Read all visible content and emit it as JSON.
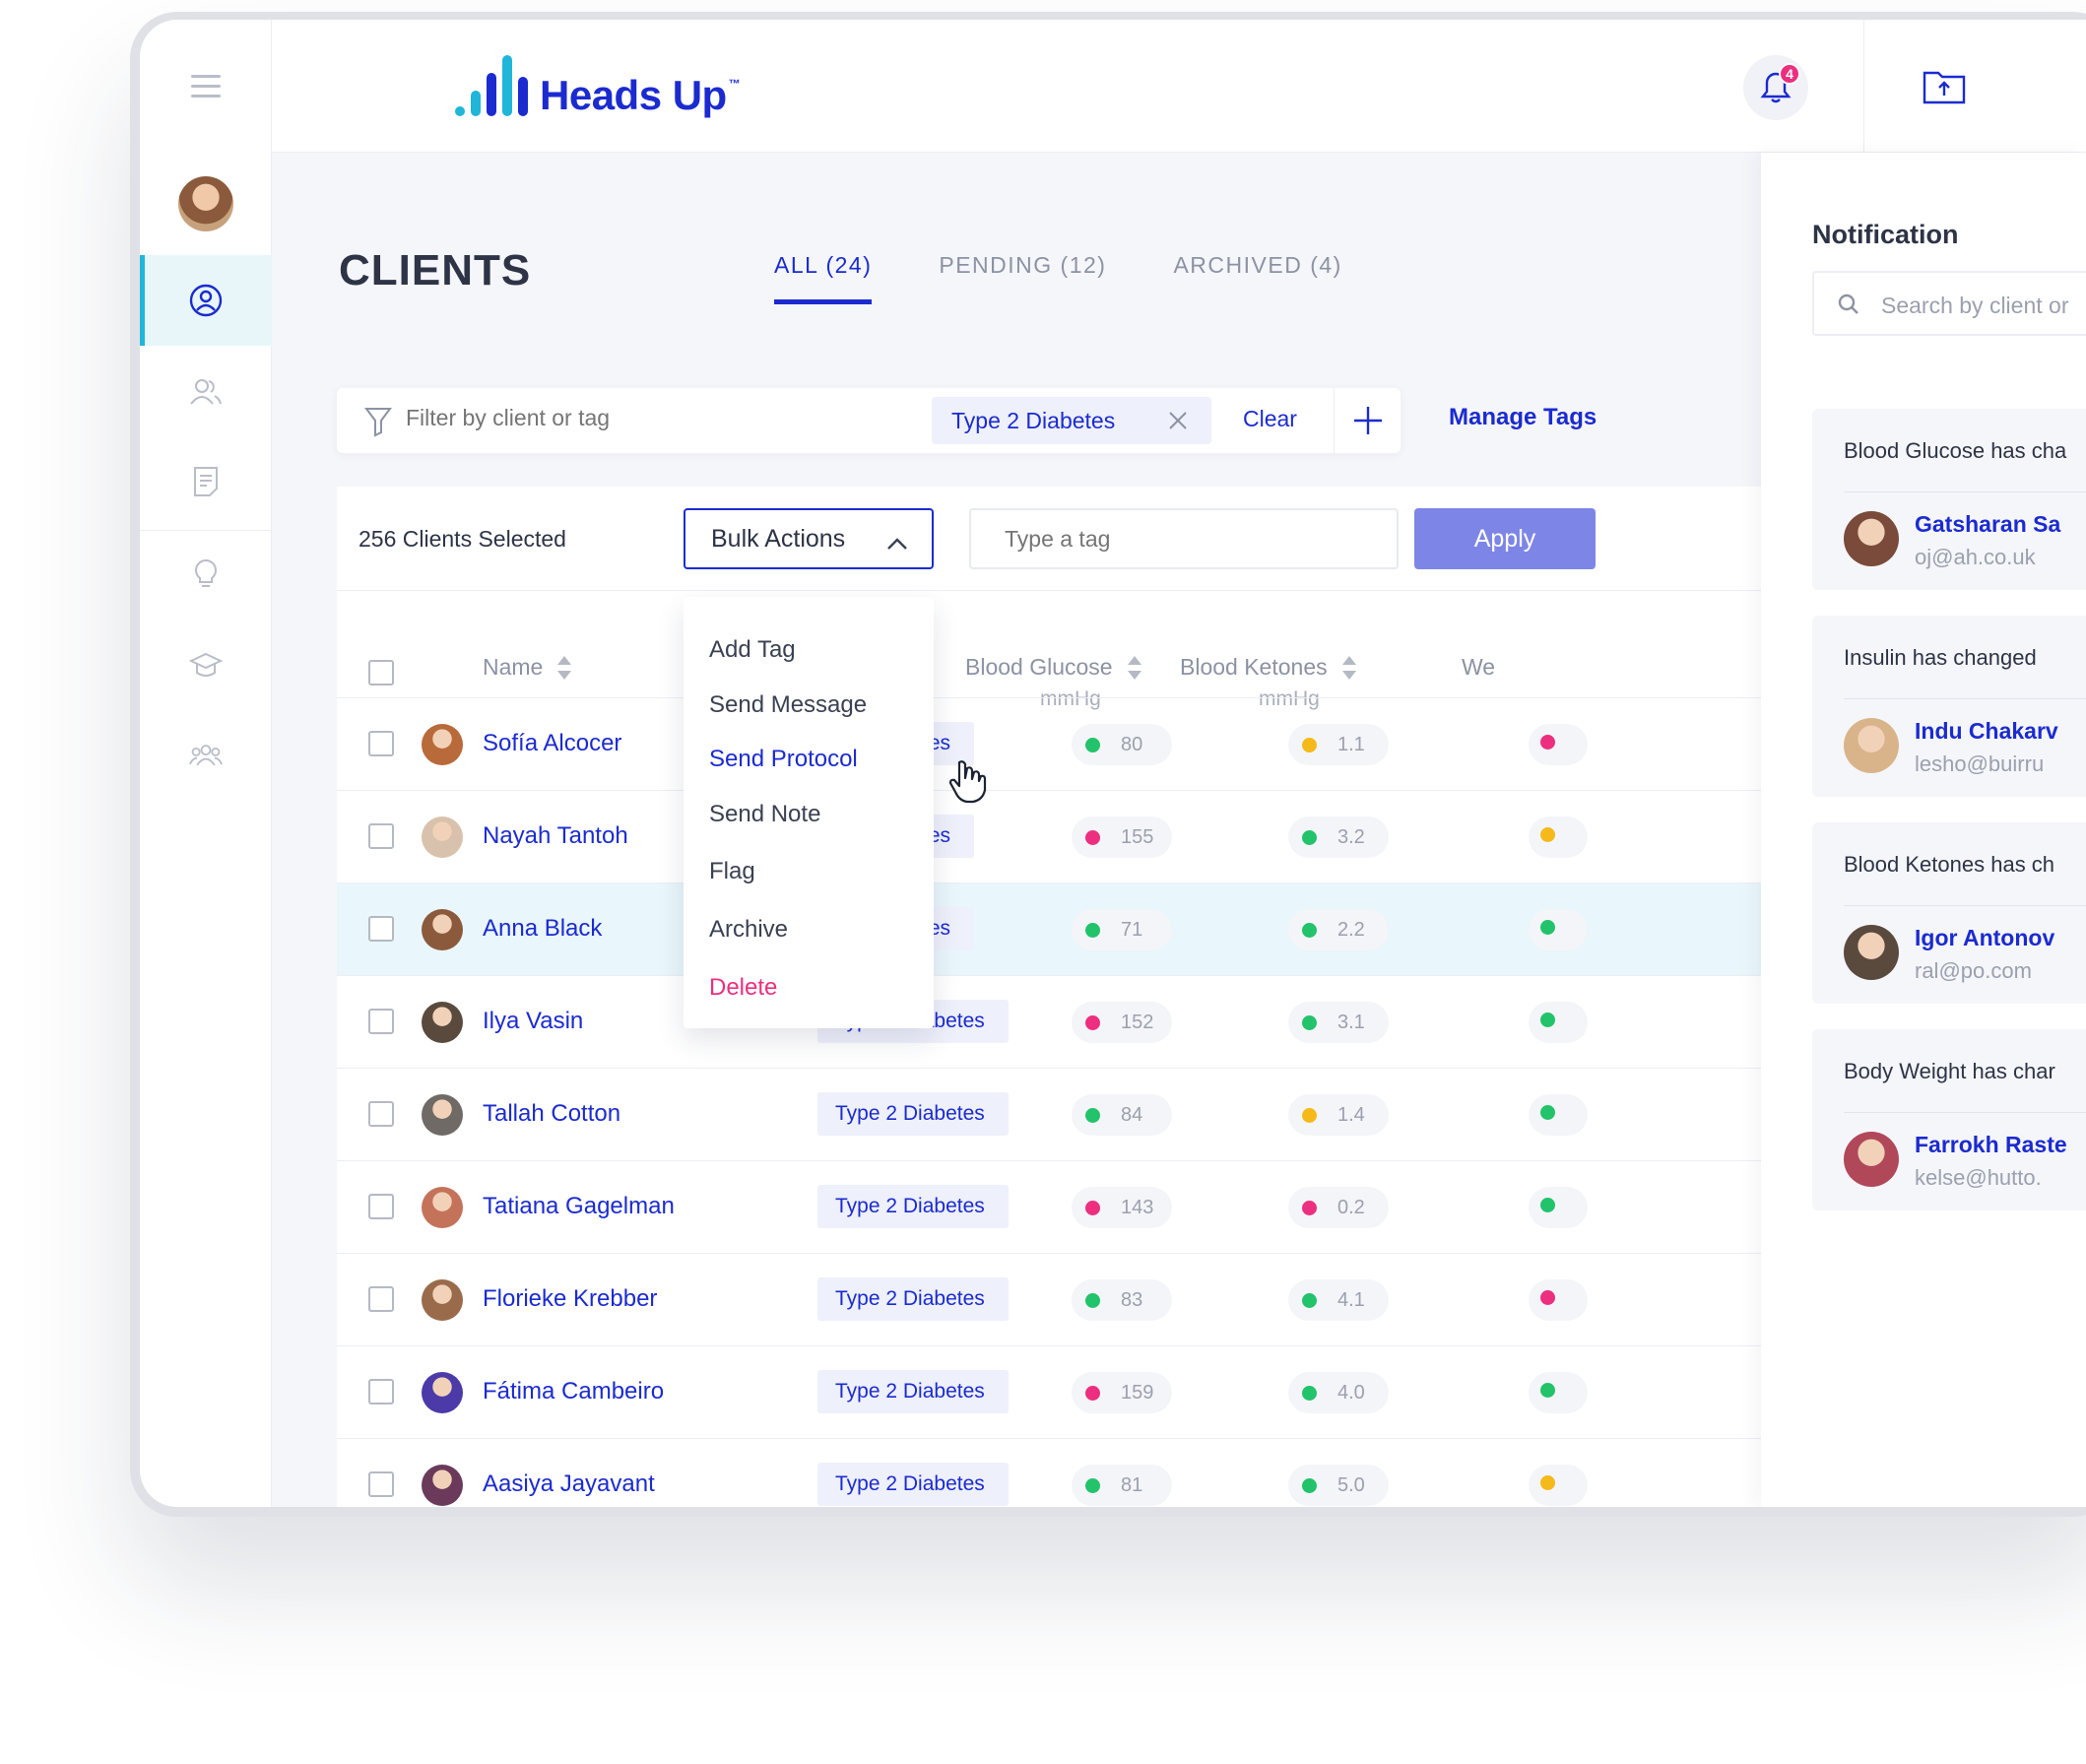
{
  "brand": {
    "name": "Heads Up",
    "tm": "™"
  },
  "colors": {
    "primary": "#1b2bd0",
    "accent_cyan": "#1fb6d9",
    "pink": "#ec2f7f",
    "green": "#22c36b",
    "yellow": "#f6b91a",
    "apply_bg": "#7d86e6"
  },
  "header": {
    "notification_count": "4",
    "bell_icon": "bell-icon",
    "upload_icon": "folder-upload-icon"
  },
  "sidebar": {
    "items": [
      "menu-icon",
      "user-circle-icon",
      "users-icon",
      "document-icon",
      "lightbulb-icon",
      "graduation-cap-icon",
      "group-icon"
    ]
  },
  "page": {
    "title": "CLIENTS",
    "tabs": [
      {
        "label": "ALL (24)",
        "active": true
      },
      {
        "label": "PENDING (12)",
        "active": false
      },
      {
        "label": "ARCHIVED (4)",
        "active": false
      }
    ]
  },
  "filter": {
    "placeholder": "Filter by client or tag",
    "tag": "Type 2 Diabetes",
    "clear": "Clear",
    "manage_tags": "Manage Tags"
  },
  "toolbar": {
    "selected": "256 Clients Selected",
    "bulk_actions": "Bulk Actions",
    "tag_placeholder": "Type a tag",
    "apply": "Apply"
  },
  "bulk_menu": [
    "Add Tag",
    "Send Message",
    "Send Protocol",
    "Send Note",
    "Flag",
    "Archive",
    "Delete"
  ],
  "table": {
    "columns": {
      "name": "Name",
      "glucose": "Blood Glucose",
      "glucose_unit": "mmHg",
      "ketones": "Blood Ketones",
      "ketones_unit": "mmHg",
      "weight": "We"
    },
    "rows": [
      {
        "name": "Sofía Alcocer",
        "tag": "Type 2 Diabetes",
        "tag_visible": "abetes",
        "glucose": "80",
        "g_color": "#22c36b",
        "ketones": "1.1",
        "k_color": "#f6b91a",
        "w_color": "#ec2f7f"
      },
      {
        "name": "Nayah Tantoh",
        "tag": "Type 2 Diabetes",
        "tag_visible": "abetes",
        "glucose": "155",
        "g_color": "#ec2f7f",
        "ketones": "3.2",
        "k_color": "#22c36b",
        "w_color": "#f6b91a"
      },
      {
        "name": "Anna Black",
        "tag": "Type 2 Diabetes",
        "tag_visible": "abetes",
        "glucose": "71",
        "g_color": "#22c36b",
        "ketones": "2.2",
        "k_color": "#22c36b",
        "w_color": "#22c36b"
      },
      {
        "name": "Ilya Vasin",
        "tag": "Type 2 Diabetes",
        "glucose": "152",
        "g_color": "#ec2f7f",
        "ketones": "3.1",
        "k_color": "#22c36b",
        "w_color": "#22c36b"
      },
      {
        "name": "Tallah Cotton",
        "tag": "Type 2 Diabetes",
        "glucose": "84",
        "g_color": "#22c36b",
        "ketones": "1.4",
        "k_color": "#f6b91a",
        "w_color": "#22c36b"
      },
      {
        "name": "Tatiana Gagelman",
        "tag": "Type 2 Diabetes",
        "glucose": "143",
        "g_color": "#ec2f7f",
        "ketones": "0.2",
        "k_color": "#ec2f7f",
        "w_color": "#22c36b"
      },
      {
        "name": "Florieke Krebber",
        "tag": "Type 2 Diabetes",
        "glucose": "83",
        "g_color": "#22c36b",
        "ketones": "4.1",
        "k_color": "#22c36b",
        "w_color": "#ec2f7f"
      },
      {
        "name": "Fátima Cambeiro",
        "tag": "Type 2 Diabetes",
        "glucose": "159",
        "g_color": "#ec2f7f",
        "ketones": "4.0",
        "k_color": "#22c36b",
        "w_color": "#22c36b"
      },
      {
        "name": "Aasiya Jayavant",
        "tag": "Type 2 Diabetes",
        "glucose": "81",
        "g_color": "#22c36b",
        "ketones": "5.0",
        "k_color": "#22c36b",
        "w_color": "#f6b91a"
      }
    ]
  },
  "notifications": {
    "title": "Notification",
    "search_placeholder": "Search by client or",
    "items": [
      {
        "title": "Blood Glucose has cha",
        "name": "Gatsharan Sa",
        "email": "oj@ah.co.uk"
      },
      {
        "title": "Insulin has changed",
        "name": "Indu Chakarv",
        "email": "lesho@buirru"
      },
      {
        "title": "Blood Ketones has ch",
        "name": "Igor Antonov",
        "email": "ral@po.com"
      },
      {
        "title": "Body Weight has char",
        "name": "Farrokh Raste",
        "email": "kelse@hutto."
      }
    ]
  }
}
